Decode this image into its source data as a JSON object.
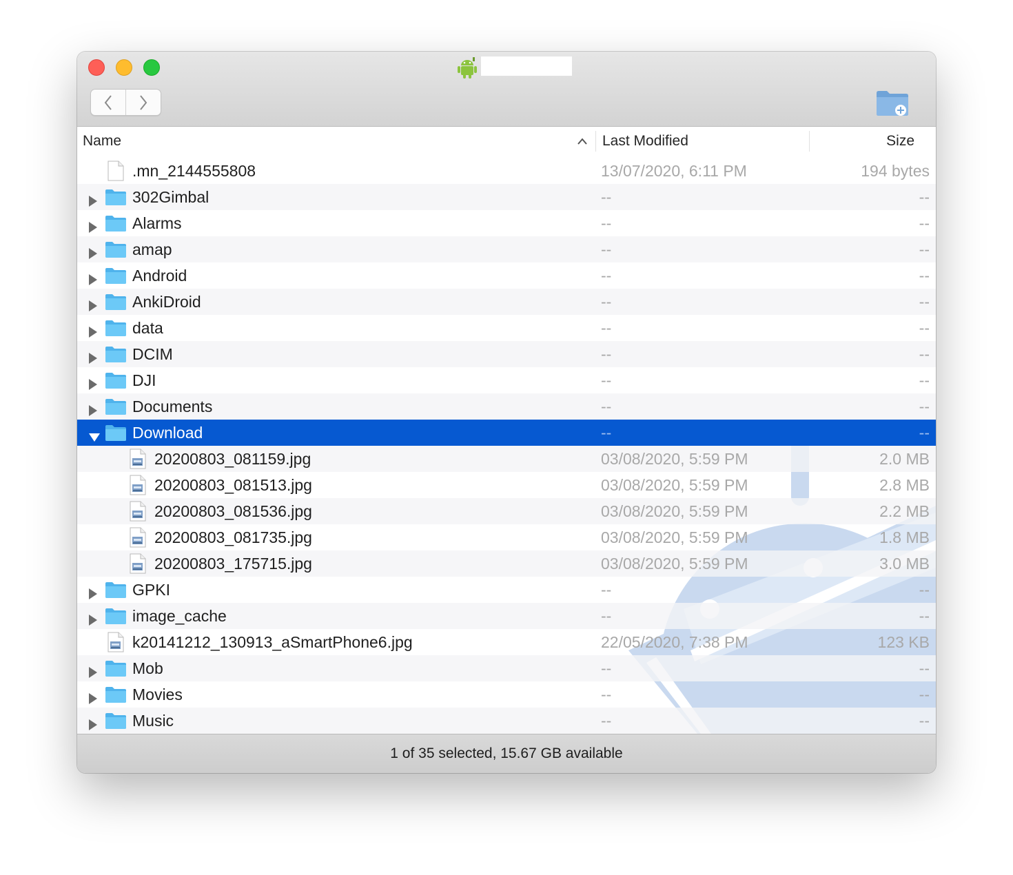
{
  "window": {
    "title": ""
  },
  "toolbar": {
    "back_icon": "chevron-left-icon",
    "forward_icon": "chevron-right-icon",
    "new_folder_icon": "new-folder-icon"
  },
  "columns": {
    "name": "Name",
    "modified": "Last Modified",
    "size": "Size",
    "sort_icon": "sort-ascending-icon"
  },
  "rows": [
    {
      "type": "file",
      "indent": 0,
      "name": ".mn_2144555808",
      "modified": "13/07/2020, 6:11 PM",
      "size": "194 bytes"
    },
    {
      "type": "folder",
      "indent": 0,
      "name": "302Gimbal",
      "modified": "--",
      "size": "--"
    },
    {
      "type": "folder",
      "indent": 0,
      "name": "Alarms",
      "modified": "--",
      "size": "--"
    },
    {
      "type": "folder",
      "indent": 0,
      "name": "amap",
      "modified": "--",
      "size": "--"
    },
    {
      "type": "folder",
      "indent": 0,
      "name": "Android",
      "modified": "--",
      "size": "--"
    },
    {
      "type": "folder",
      "indent": 0,
      "name": "AnkiDroid",
      "modified": "--",
      "size": "--"
    },
    {
      "type": "folder",
      "indent": 0,
      "name": "data",
      "modified": "--",
      "size": "--"
    },
    {
      "type": "folder",
      "indent": 0,
      "name": "DCIM",
      "modified": "--",
      "size": "--"
    },
    {
      "type": "folder",
      "indent": 0,
      "name": "DJI",
      "modified": "--",
      "size": "--"
    },
    {
      "type": "folder",
      "indent": 0,
      "name": "Documents",
      "modified": "--",
      "size": "--"
    },
    {
      "type": "folder",
      "indent": 0,
      "name": "Download",
      "modified": "--",
      "size": "--",
      "expanded": true,
      "selected": true
    },
    {
      "type": "image",
      "indent": 1,
      "name": "20200803_081159.jpg",
      "modified": "03/08/2020, 5:59 PM",
      "size": "2.0 MB"
    },
    {
      "type": "image",
      "indent": 1,
      "name": "20200803_081513.jpg",
      "modified": "03/08/2020, 5:59 PM",
      "size": "2.8 MB"
    },
    {
      "type": "image",
      "indent": 1,
      "name": "20200803_081536.jpg",
      "modified": "03/08/2020, 5:59 PM",
      "size": "2.2 MB"
    },
    {
      "type": "image",
      "indent": 1,
      "name": "20200803_081735.jpg",
      "modified": "03/08/2020, 5:59 PM",
      "size": "1.8 MB"
    },
    {
      "type": "image",
      "indent": 1,
      "name": "20200803_175715.jpg",
      "modified": "03/08/2020, 5:59 PM",
      "size": "3.0 MB"
    },
    {
      "type": "folder",
      "indent": 0,
      "name": "GPKI",
      "modified": "--",
      "size": "--"
    },
    {
      "type": "folder",
      "indent": 0,
      "name": "image_cache",
      "modified": "--",
      "size": "--"
    },
    {
      "type": "image",
      "indent": 0,
      "name": "k20141212_130913_aSmartPhone6.jpg",
      "modified": "22/05/2020, 7:38 PM",
      "size": "123 KB"
    },
    {
      "type": "folder",
      "indent": 0,
      "name": "Mob",
      "modified": "--",
      "size": "--"
    },
    {
      "type": "folder",
      "indent": 0,
      "name": "Movies",
      "modified": "--",
      "size": "--"
    },
    {
      "type": "folder",
      "indent": 0,
      "name": "Music",
      "modified": "--",
      "size": "--"
    }
  ],
  "status": {
    "text": "1 of 35 selected, 15.67 GB available"
  },
  "colors": {
    "selection": "#0659d1",
    "folder": "#5ec2f5",
    "watermark": "#c8d8ee"
  }
}
